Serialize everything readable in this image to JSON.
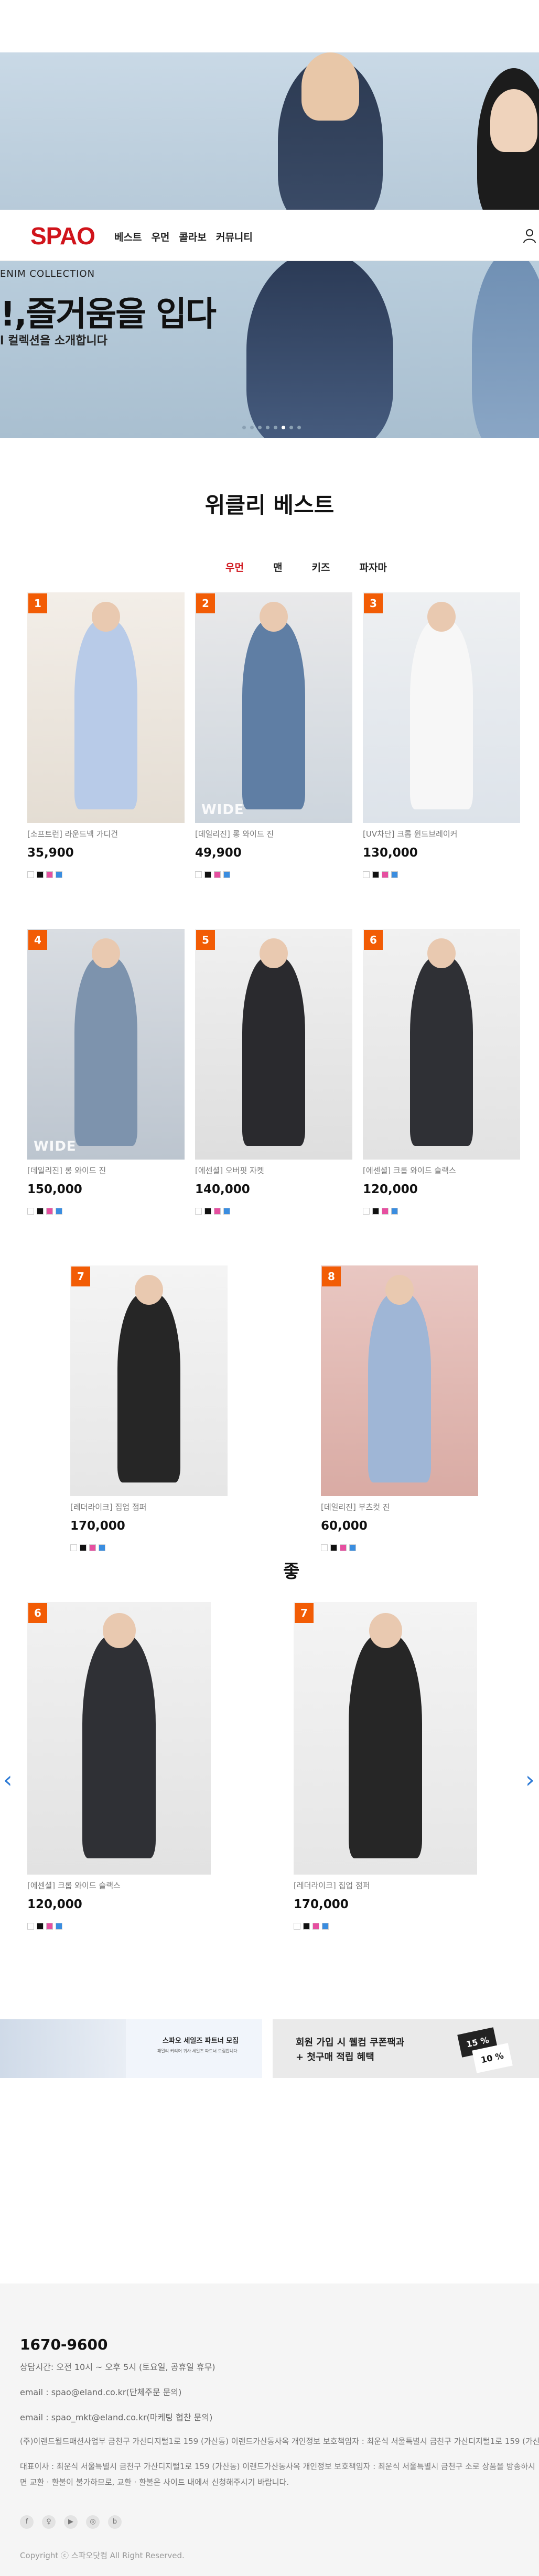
{
  "header": {
    "logo": "SPAO",
    "nav": [
      "베스트",
      "우먼",
      "콜라보",
      "커뮤니티"
    ]
  },
  "hero": {
    "subtitle": "ENIM COLLECTION",
    "title": "!,즐거움을 입다",
    "description": "l 컬렉션을 소개합니다",
    "slide_count": 8,
    "active_slide": 6
  },
  "weekly_best": {
    "title": "위클리 베스트",
    "tabs": [
      "우먼",
      "맨",
      "키즈",
      "파자마"
    ],
    "active_tab": "우먼",
    "items": [
      {
        "rank": "1",
        "name": "[소프트런] 라운드넥 가디건",
        "price": "35,900",
        "badge": ""
      },
      {
        "rank": "2",
        "name": "[데일리진] 롱 와이드 진",
        "price": "49,900",
        "badge": "WIDE"
      },
      {
        "rank": "3",
        "name": "[UV차단] 크롭 윈드브레이커",
        "price": "130,000",
        "badge": ""
      },
      {
        "rank": "4",
        "name": "[데일리진] 롱 와이드 진",
        "price": "150,000",
        "badge": "WIDE"
      },
      {
        "rank": "5",
        "name": "[에센셜] 오버핏 자켓",
        "price": "140,000",
        "badge": ""
      },
      {
        "rank": "6",
        "name": "[에센셜] 크롭 와이드 슬랙스",
        "price": "120,000",
        "badge": ""
      },
      {
        "rank": "7",
        "name": "[레더라이크] 집업 점퍼",
        "price": "170,000",
        "badge": ""
      },
      {
        "rank": "8",
        "name": "[데일리진] 부츠컷 진",
        "price": "60,000",
        "badge": ""
      }
    ],
    "carousel": [
      {
        "rank": "6",
        "name": "[에센셜] 크롭 와이드 슬랙스",
        "price": "120,000"
      },
      {
        "rank": "7",
        "name": "[레더라이크] 집업 점퍼",
        "price": "170,000"
      }
    ],
    "carousel_fragment": "좋"
  },
  "banners": {
    "left_title": "스파오 세일즈 파트너 모집",
    "left_desc": "패밀리 커리어 귀사 세일즈 파트너 모집합니다",
    "right_line1": "회원 가입 시 웰컴 쿠폰팩과",
    "right_line2": "+ 첫구매 적립 혜택",
    "coupon1": "15 %",
    "coupon2": "10 %"
  },
  "footer": {
    "phone": "1670-9600",
    "hours": "상담시간: 오전 10시 ~ 오후 5시 (토요일, 공휴일 휴무)",
    "email1": "email : spao@eland.co.kr(단체주문 문의)",
    "email2": "email : spao_mkt@eland.co.kr(마케팅 협찬 문의)",
    "company": "(주)이랜드월드패션사업부 금천구 가산디지털1로 159 (가산동) 이랜드가산동사옥 개인정보 보호책임자 : 최운식 서울특별시 금천구 가산디지털1로 159 (가산동) : 113-85-19030 [사업자정보확인] 통신판매업 신고번호 : 제 2005-01053 호",
    "notice": "대표이사 : 최운식 서울특별시 금천구 가산디지털1로 159 (가산동) 이랜드가산동사옥 개인정보 보호책임자 : 최운식 서울특별시 금천구 소로 상품을 방송하시면 교환 · 환불이 불가하므로, 교환 · 환불은 사이트 내에서 신청해주시기 바랍니다.",
    "copyright": "Copyright ⓒ 스파오닷컴 All Right Reserved.",
    "sns": [
      "f",
      "♀",
      "▶",
      "◎",
      "b"
    ]
  },
  "swatch_colors": [
    "#ffffff",
    "#111111",
    "#e64fa0",
    "#3a8de0"
  ]
}
